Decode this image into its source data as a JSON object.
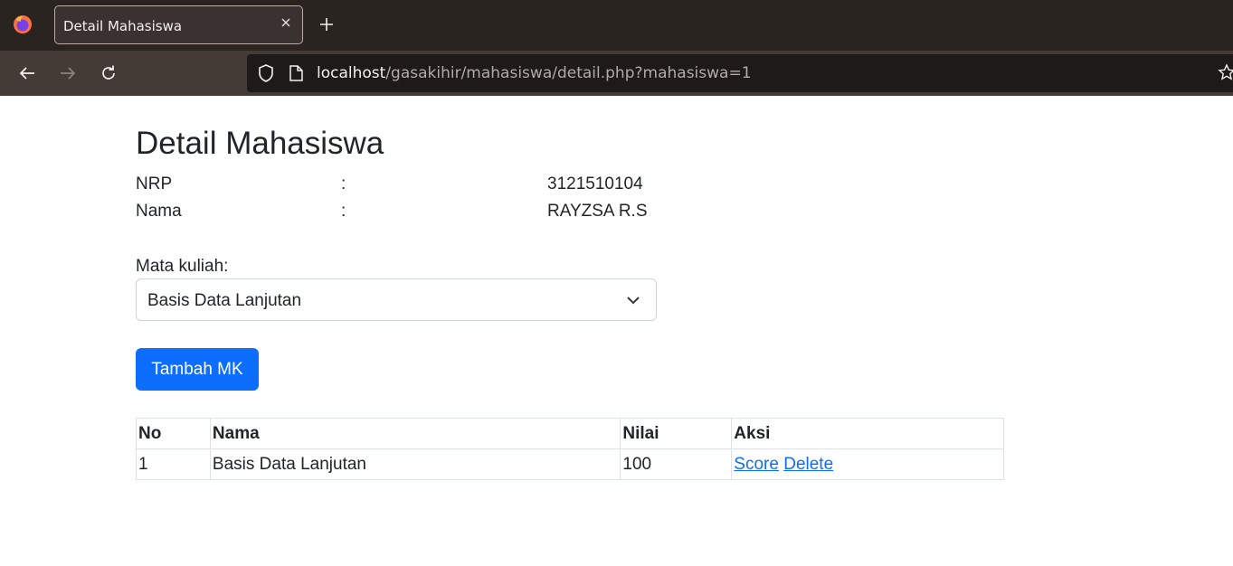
{
  "browser": {
    "tab_title": "Detail Mahasiswa",
    "url_host": "localhost",
    "url_path": "/gasakihir/mahasiswa/detail.php?mahasiswa=1",
    "colors": {
      "tabbar": "#2a2421",
      "navbar": "#443b37",
      "urlbar": "#1d1a19"
    }
  },
  "page": {
    "title": "Detail Mahasiswa",
    "info": [
      {
        "label": "NRP",
        "colon": ":",
        "value": "3121510104"
      },
      {
        "label": "Nama",
        "colon": ":",
        "value": "RAYZSA R.S"
      }
    ],
    "mk_label": "Mata kuliah:",
    "mk_selected": "Basis Data Lanjutan",
    "add_button": "Tambah MK",
    "table": {
      "headers": [
        "No",
        "Nama",
        "Nilai",
        "Aksi"
      ],
      "rows": [
        {
          "no": "1",
          "nama": "Basis Data Lanjutan",
          "nilai": "100",
          "score_link": "Score",
          "delete_link": "Delete"
        }
      ]
    }
  },
  "icons": [
    "firefox-logo-icon",
    "close-icon",
    "plus-icon",
    "back-arrow-icon",
    "forward-arrow-icon",
    "reload-icon",
    "shield-icon",
    "page-icon",
    "star-icon",
    "chevron-down-icon"
  ],
  "colors": {
    "primary": "#0d6efd",
    "text": "#212529",
    "border": "#dee2e6"
  }
}
